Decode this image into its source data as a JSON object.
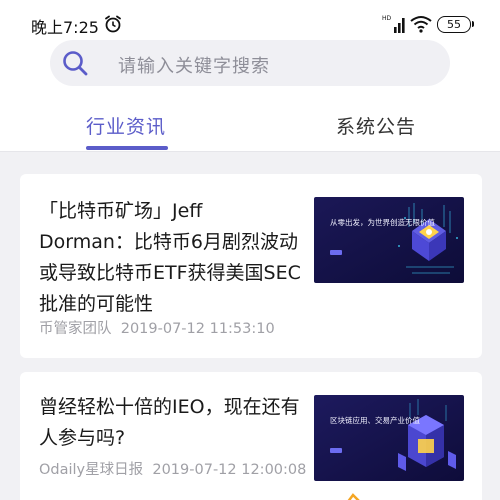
{
  "status_bar": {
    "time": "晚上7:25",
    "battery": "55",
    "icons": [
      "alarm-icon",
      "signal-icon",
      "wifi-icon",
      "battery-icon"
    ]
  },
  "search": {
    "placeholder": "请输入关键字搜索",
    "icon": "search-icon"
  },
  "tabs": [
    {
      "label": "行业资讯",
      "active": true
    },
    {
      "label": "系统公告",
      "active": false
    }
  ],
  "articles": [
    {
      "title": "「比特币矿场」Jeff Dorman：比特币6月剧烈波动或导致比特币ETF获得美国SEC批准的可能性",
      "author": "币管家团队",
      "datetime": "2019-07-12 11:53:10",
      "thumbnail_text": "从零出发，为世界创造无限价值"
    },
    {
      "title": "曾经轻松十倍的IEO，现在还有人参与吗?",
      "author": "Odaily星球日报",
      "datetime": "2019-07-12 12:00:08",
      "thumbnail_text": "区块链应用、交易产业价值"
    }
  ],
  "colors": {
    "accent": "#5b5cc9",
    "background": "#f1f1f4",
    "meta_text": "#a0a0a6"
  }
}
